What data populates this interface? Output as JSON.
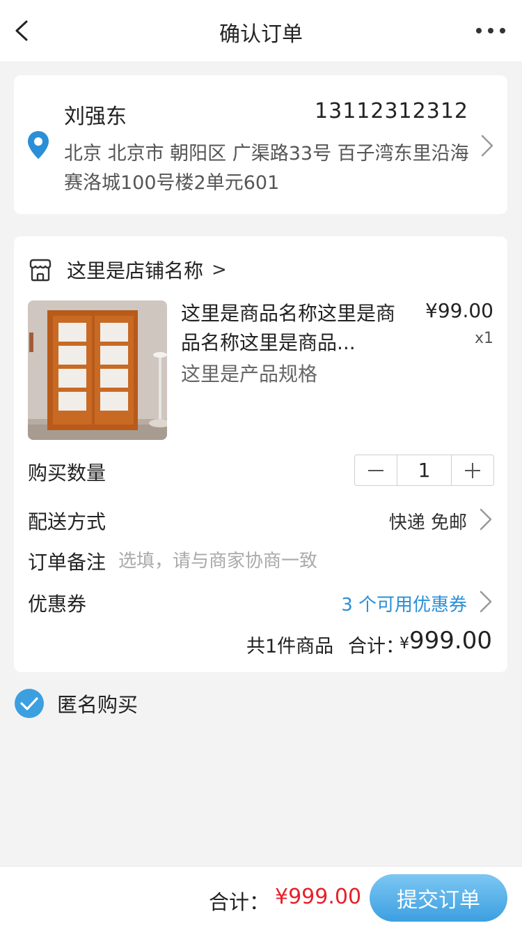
{
  "header": {
    "title": "确认订单",
    "back_icon": "chevron-left-icon",
    "more_icon": "more-dots-icon"
  },
  "address": {
    "name": "刘强东",
    "phone": "13112312312",
    "full_address": "北京 北京市 朝阳区 广渠路33号 百子湾东里沿海赛洛城100号楼2单元601",
    "icon": "location-pin-icon",
    "icon_color": "#2a8fd6"
  },
  "store": {
    "name": "这里是店铺名称",
    "arrow": ">",
    "icon": "store-icon"
  },
  "product": {
    "name": "这里是商品名称这里是商品名称这里是商品...",
    "price": "¥99.00",
    "qty_label": "x1",
    "spec": "这里是产品规格"
  },
  "quantity": {
    "label": "购买数量",
    "value": "1"
  },
  "shipping": {
    "label": "配送方式",
    "value": "快递 免邮"
  },
  "remark": {
    "label": "订单备注",
    "placeholder": "选填，请与商家协商一致"
  },
  "coupon": {
    "label": "优惠券",
    "value": "3 个可用优惠券",
    "color": "#2a8fd6"
  },
  "summary": {
    "count": "共1件商品",
    "label": "合计：",
    "currency": "¥",
    "amount": "999.00"
  },
  "anonymous": {
    "label": "匿名购买",
    "checked": true,
    "color": "#3c9fe0"
  },
  "footer": {
    "label": "合计：",
    "total": "¥999.00",
    "total_color": "#e8202a",
    "submit_label": "提交订单"
  }
}
